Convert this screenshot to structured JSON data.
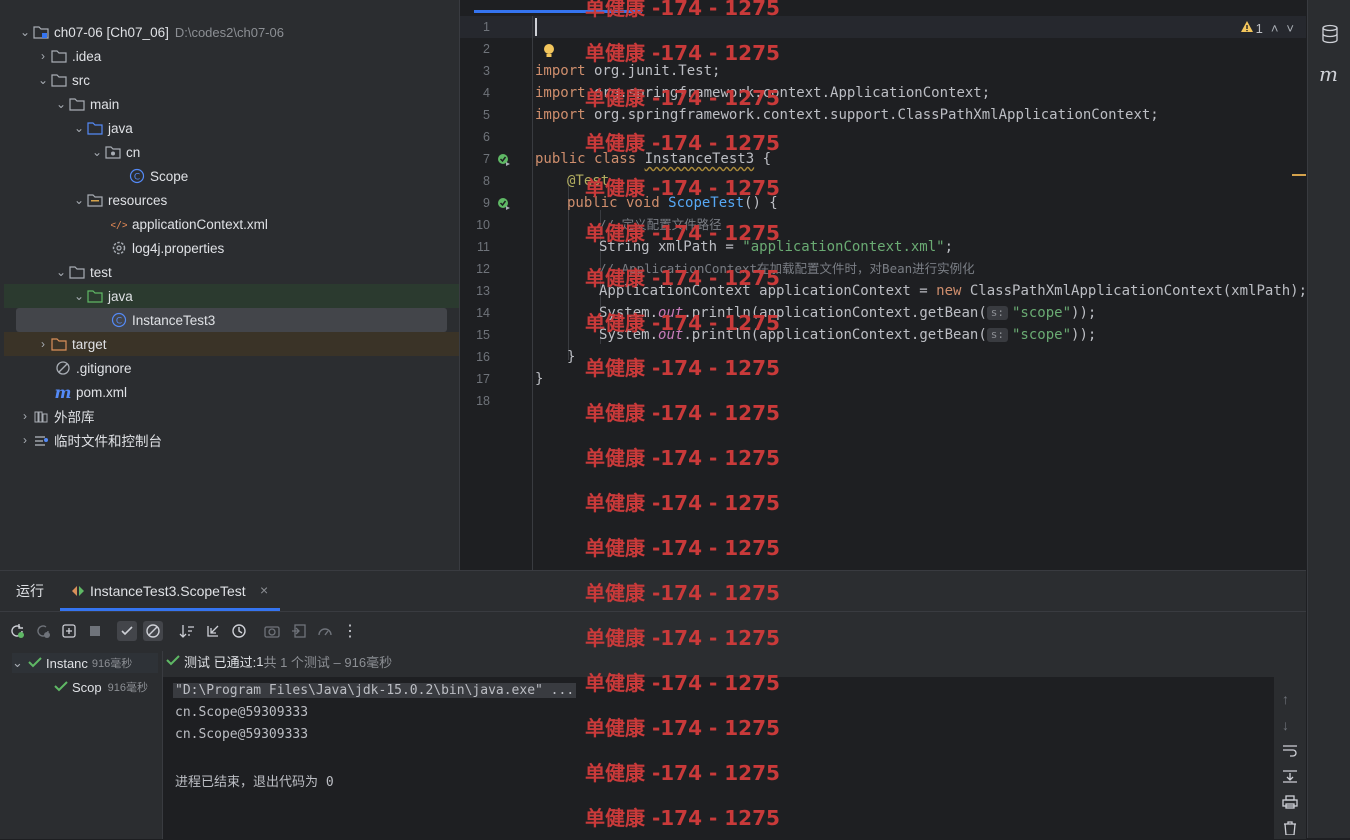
{
  "project": {
    "items": [
      {
        "label": "ch07-06 [Ch07_06]",
        "path": "D:\\codes2\\ch07-06"
      },
      {
        "label": ".idea"
      },
      {
        "label": "src"
      },
      {
        "label": "main"
      },
      {
        "label": "java"
      },
      {
        "label": "cn"
      },
      {
        "label": "Scope"
      },
      {
        "label": "resources"
      },
      {
        "label": "applicationContext.xml"
      },
      {
        "label": "log4j.properties"
      },
      {
        "label": "test"
      },
      {
        "label": "java"
      },
      {
        "label": "InstanceTest3"
      },
      {
        "label": "target"
      },
      {
        "label": ".gitignore"
      },
      {
        "label": "pom.xml"
      },
      {
        "label": "外部库"
      },
      {
        "label": "临时文件和控制台"
      }
    ]
  },
  "editor": {
    "warning_count": "1",
    "line_numbers": [
      "1",
      "2",
      "3",
      "4",
      "5",
      "6",
      "7",
      "8",
      "9",
      "10",
      "11",
      "12",
      "13",
      "14",
      "15",
      "16",
      "17",
      "18"
    ],
    "code": {
      "l3_kw": "import",
      "l3_rest": " org.junit.Test;",
      "l4_kw": "import",
      "l4_rest": " org.springframework.context.ApplicationContext;",
      "l5_kw": "import",
      "l5_rest": " org.springframework.context.support.ClassPathXmlApplicationContext;",
      "l7_kw": "public class ",
      "l7_cls": "InstanceTest3",
      "l7_rest": " {",
      "l8_ann": "@Test",
      "l9_kw": "public void ",
      "l9_fn": "ScopeTest",
      "l9_rest": "() {",
      "l10_cmt": "// 定义配置文件路径",
      "l11_a": "String xmlPath = ",
      "l11_str": "\"applicationContext.xml\"",
      "l11_b": ";",
      "l12_cmt": "// ApplicationContext在加载配置文件时，对Bean进行实例化",
      "l13_a": "ApplicationContext applicationContext = ",
      "l13_kw": "new",
      "l13_b": " ClassPathXmlApplicationContext(xmlPath);",
      "l14_a": "System.",
      "l14_out": "out",
      "l14_b": ".println(applicationContext.getBean(",
      "l14_hint": "s:",
      "l14_str": "\"scope\"",
      "l14_c": "));",
      "l15_a": "System.",
      "l15_out": "out",
      "l15_b": ".println(applicationContext.getBean(",
      "l15_hint": "s:",
      "l15_str": "\"scope\"",
      "l15_c": "));",
      "l16": "}",
      "l17": "}"
    }
  },
  "run": {
    "title": "运行",
    "tab_label": "InstanceTest3.ScopeTest",
    "tree_root": "Instanc",
    "tree_root_time": "916毫秒",
    "tree_child": "Scop",
    "tree_child_time": "916毫秒",
    "status_a": "测试 已通过: ",
    "status_b": "1",
    "status_c": "共 1 个测试 – 916毫秒",
    "console": [
      "\"D:\\Program Files\\Java\\jdk-15.0.2\\bin\\java.exe\" ...",
      "cn.Scope@59309333",
      "cn.Scope@59309333",
      "",
      "进程已结束，退出代码为 0"
    ]
  },
  "watermark": "单健康 -174 - 1275",
  "colors": {
    "accent": "#3574f0",
    "pass": "#5fb865",
    "string": "#6aab73",
    "keyword": "#cf8e6d",
    "watermark": "#c93a3a"
  }
}
